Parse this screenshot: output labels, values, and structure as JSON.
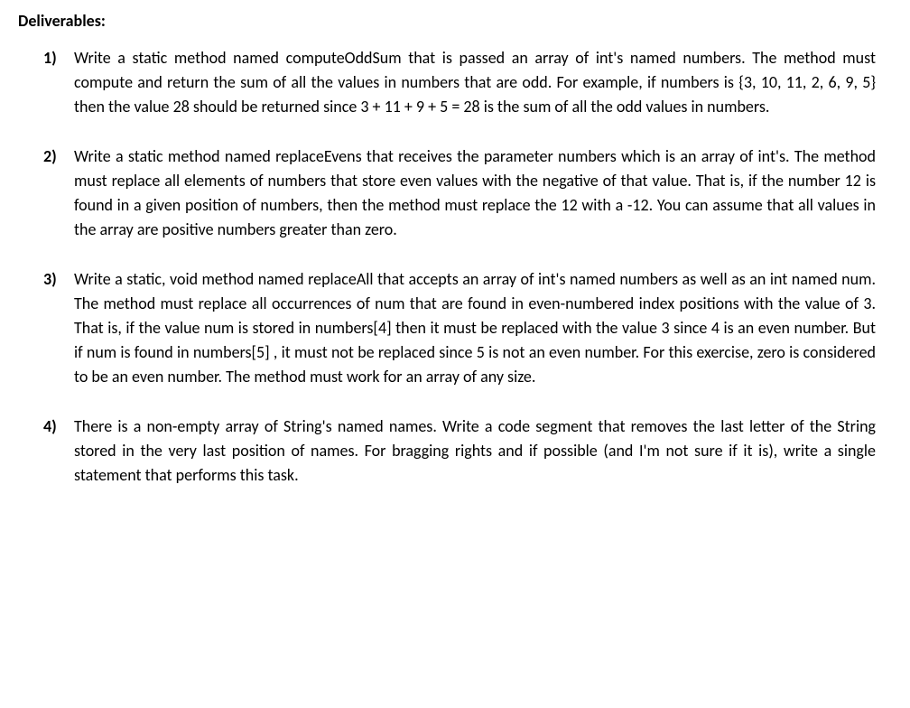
{
  "heading": "Deliverables:",
  "items": [
    {
      "number": "1)",
      "text": "Write a static method named computeOddSum that is passed an array of int's named numbers. The method must compute and return the sum of all the values in numbers that are odd. For example, if numbers is {3, 10, 11, 2, 6, 9, 5} then the value 28 should be returned since 3 + 11 + 9 + 5 = 28 is the sum of all the odd values in numbers."
    },
    {
      "number": "2)",
      "text": "Write a static method named replaceEvens that receives the parameter numbers which is an array of int's. The method must replace all elements of numbers that store even values with the negative of that value. That is, if the number 12 is found in a given position of numbers, then the method must replace the 12 with a -12. You can assume that all values in the array are positive numbers greater than zero."
    },
    {
      "number": "3)",
      "text": "Write a static, void method named replaceAll that accepts an array of int's named numbers as well as an int named num. The method must replace all occurrences of num that are found in even-numbered index positions with the value of 3. That is, if the value num is stored in numbers[4] then it must be replaced with the value 3 since 4 is an even number. But if num is found in numbers[5] , it must not be replaced since 5 is not an even number. For this exercise, zero is considered to be an even number. The method must work for an array of any size."
    },
    {
      "number": "4)",
      "text": "There is a non-empty array of String's named names. Write a code segment that removes the last letter of the String stored in the very last position of names. For bragging rights and if possible (and I'm not sure if it is), write a single statement that performs this task."
    }
  ]
}
